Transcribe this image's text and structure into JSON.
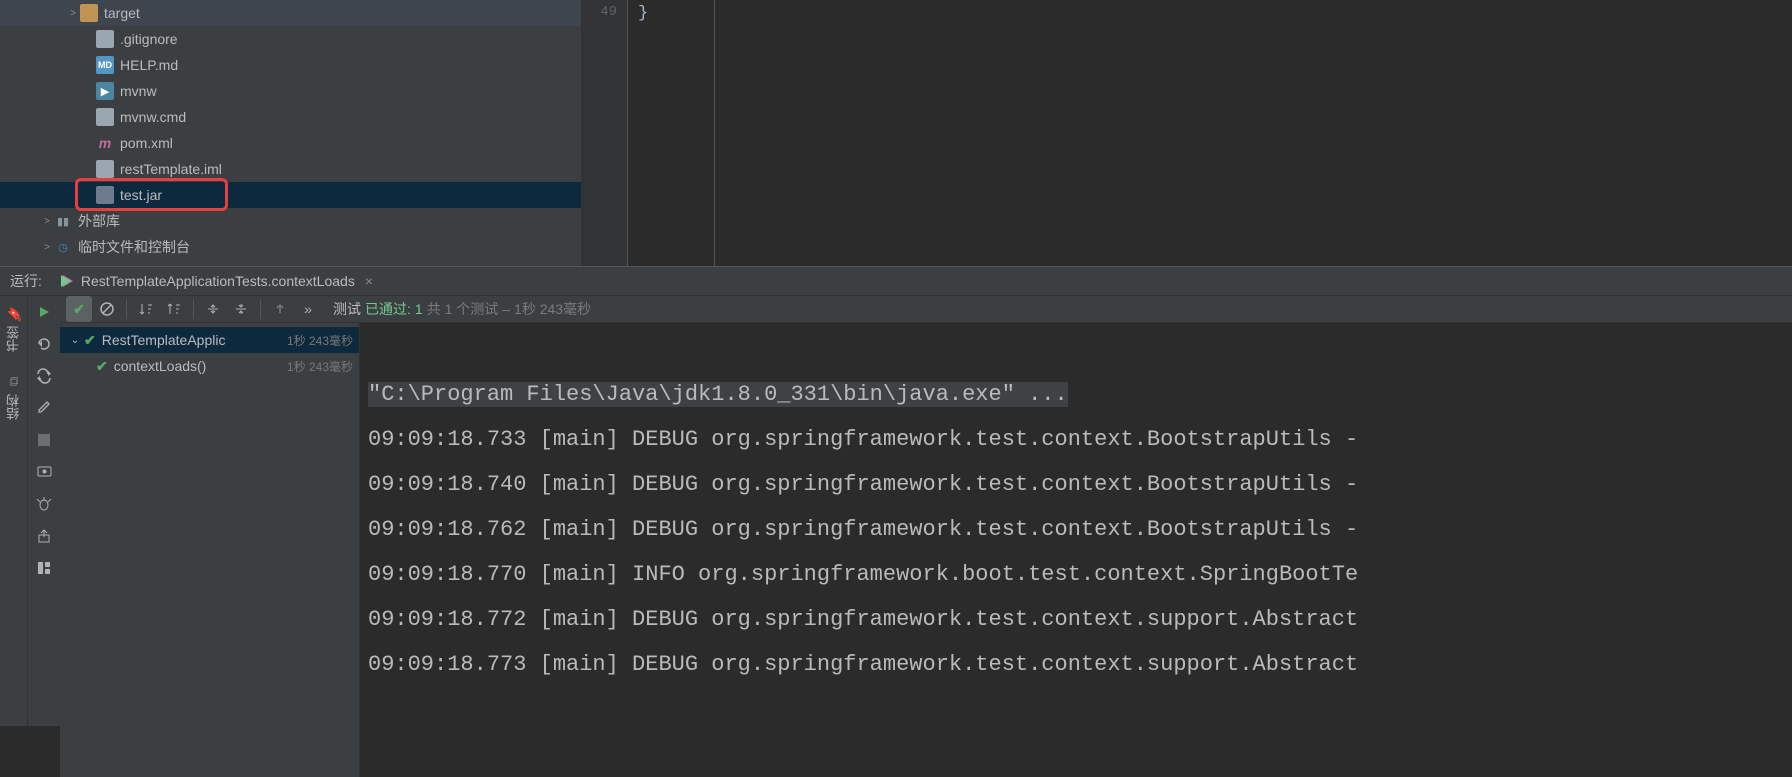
{
  "tree": {
    "items": [
      {
        "indent": 58,
        "arrow": ">",
        "icon": "folder-orange",
        "iconText": "",
        "label": "target"
      },
      {
        "indent": 74,
        "arrow": "",
        "icon": "txt",
        "iconText": "",
        "label": ".gitignore"
      },
      {
        "indent": 74,
        "arrow": "",
        "icon": "md",
        "iconText": "MD",
        "label": "HELP.md"
      },
      {
        "indent": 74,
        "arrow": "",
        "icon": "play",
        "iconText": "▶",
        "label": "mvnw"
      },
      {
        "indent": 74,
        "arrow": "",
        "icon": "txt",
        "iconText": "",
        "label": "mvnw.cmd"
      },
      {
        "indent": 74,
        "arrow": "",
        "icon": "xml-m",
        "iconText": "m",
        "label": "pom.xml"
      },
      {
        "indent": 74,
        "arrow": "",
        "icon": "txt",
        "iconText": "",
        "label": "restTemplate.iml"
      },
      {
        "indent": 74,
        "arrow": "",
        "icon": "jar",
        "iconText": "",
        "label": "test.jar",
        "selected": true
      },
      {
        "indent": 32,
        "arrow": ">",
        "icon": "lib",
        "iconText": "▮▮",
        "label": "外部库"
      },
      {
        "indent": 32,
        "arrow": ">",
        "icon": "clock",
        "iconText": "◷",
        "label": "临时文件和控制台"
      }
    ]
  },
  "editor": {
    "lineNo": "49",
    "code": "}"
  },
  "run": {
    "label": "运行:",
    "tabTitle": "RestTemplateApplicationTests.contextLoads",
    "status": {
      "prefix": "测试",
      "passed": "已通过:",
      "count": "1",
      "of": "共 1 个测试",
      "dash": "–",
      "time": "1秒 243毫秒"
    }
  },
  "tests": {
    "root": {
      "name": "RestTemplateApplic",
      "time": "1秒 243毫秒"
    },
    "child": {
      "name": "contextLoads()",
      "time": "1秒 243毫秒"
    }
  },
  "console": {
    "cmd": "\"C:\\Program Files\\Java\\jdk1.8.0_331\\bin\\java.exe\" ...",
    "lines": [
      "09:09:18.733 [main] DEBUG org.springframework.test.context.BootstrapUtils -",
      "09:09:18.740 [main] DEBUG org.springframework.test.context.BootstrapUtils -",
      "09:09:18.762 [main] DEBUG org.springframework.test.context.BootstrapUtils -",
      "09:09:18.770 [main] INFO org.springframework.boot.test.context.SpringBootTe",
      "09:09:18.772 [main] DEBUG org.springframework.test.context.support.Abstract",
      "09:09:18.773 [main] DEBUG org.springframework.test.context.support.Abstract"
    ]
  },
  "sidebar": {
    "bookmark": "书签",
    "structure": "结构"
  }
}
